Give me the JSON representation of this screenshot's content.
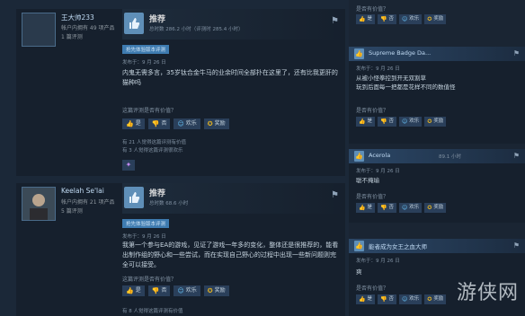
{
  "colors": {
    "background": "#1b2838",
    "card": "#16202d",
    "accent": "#67c1f5",
    "tag": "#3e7bb0",
    "award": "#e6b422"
  },
  "reviews": [
    {
      "author": "王大帅233",
      "owned": "帐户内拥有 49 项产品",
      "review_count": "1 篇评测",
      "verdict": "推荐",
      "hours": "总时数 286.2 小时（评测时 285.4 小时）",
      "tag": "抢先体验版本评测",
      "date": "发布于：9 月 26 日",
      "text": "内鬼无需多言，35岁钛合金牛马的业余时间全部扑在这里了，还有比我更肝的猫种吗",
      "question": "这篇评测是否有价值？",
      "buttons": {
        "yes": "是",
        "no": "否",
        "funny": "欢乐",
        "award": "奖励"
      },
      "stat1": "有 21 人觉得这篇评测有价值",
      "stat2": "有 3 人觉得这篇评测很欢乐"
    },
    {
      "author": "Keelah Se'lai",
      "owned": "帐户内拥有 21 项产品",
      "review_count": "5 篇评测",
      "verdict": "推荐",
      "hours": "总时数 68.6 小时",
      "tag": "抢先体验版本评测",
      "date": "发布于：9 月 26 日",
      "text": "我第一个参与EA的游戏，见证了游戏一年多的变化，整体还是很推荐的，能看出制作组的野心和一些尝试，而在实现自己野心的过程中出现一些新问题则完全可以接受。",
      "question": "这篇评测是否有价值？",
      "buttons": {
        "yes": "是",
        "no": "否",
        "funny": "欢乐",
        "award": "奖励"
      },
      "stat1": "有 8 人觉得这篇评测有价值"
    }
  ],
  "sidebar": {
    "top_question": "是否有价值？",
    "buttons": {
      "yes": "是",
      "no": "否",
      "funny": "欢乐",
      "award": "奖励"
    },
    "cards": [
      {
        "name": "Supreme Badge Da...",
        "hours": "",
        "date": "发布于：9 月 26 日",
        "text": "从被小怪拳控到开无双割草\n玩到后面每一把都是花样不同的数值怪",
        "question": "是否有价值？"
      },
      {
        "name": "Acerola",
        "hours": "89.1 小时",
        "date": "发布于：9 月 26 日",
        "text": "聪不掩瑜",
        "question": "是否有价值？"
      },
      {
        "name": "能者成为女王之血大师",
        "hours": "",
        "date": "发布于：9 月 26 日",
        "text": "爽",
        "question": "是否有价值？"
      }
    ]
  },
  "watermark": "游侠网"
}
